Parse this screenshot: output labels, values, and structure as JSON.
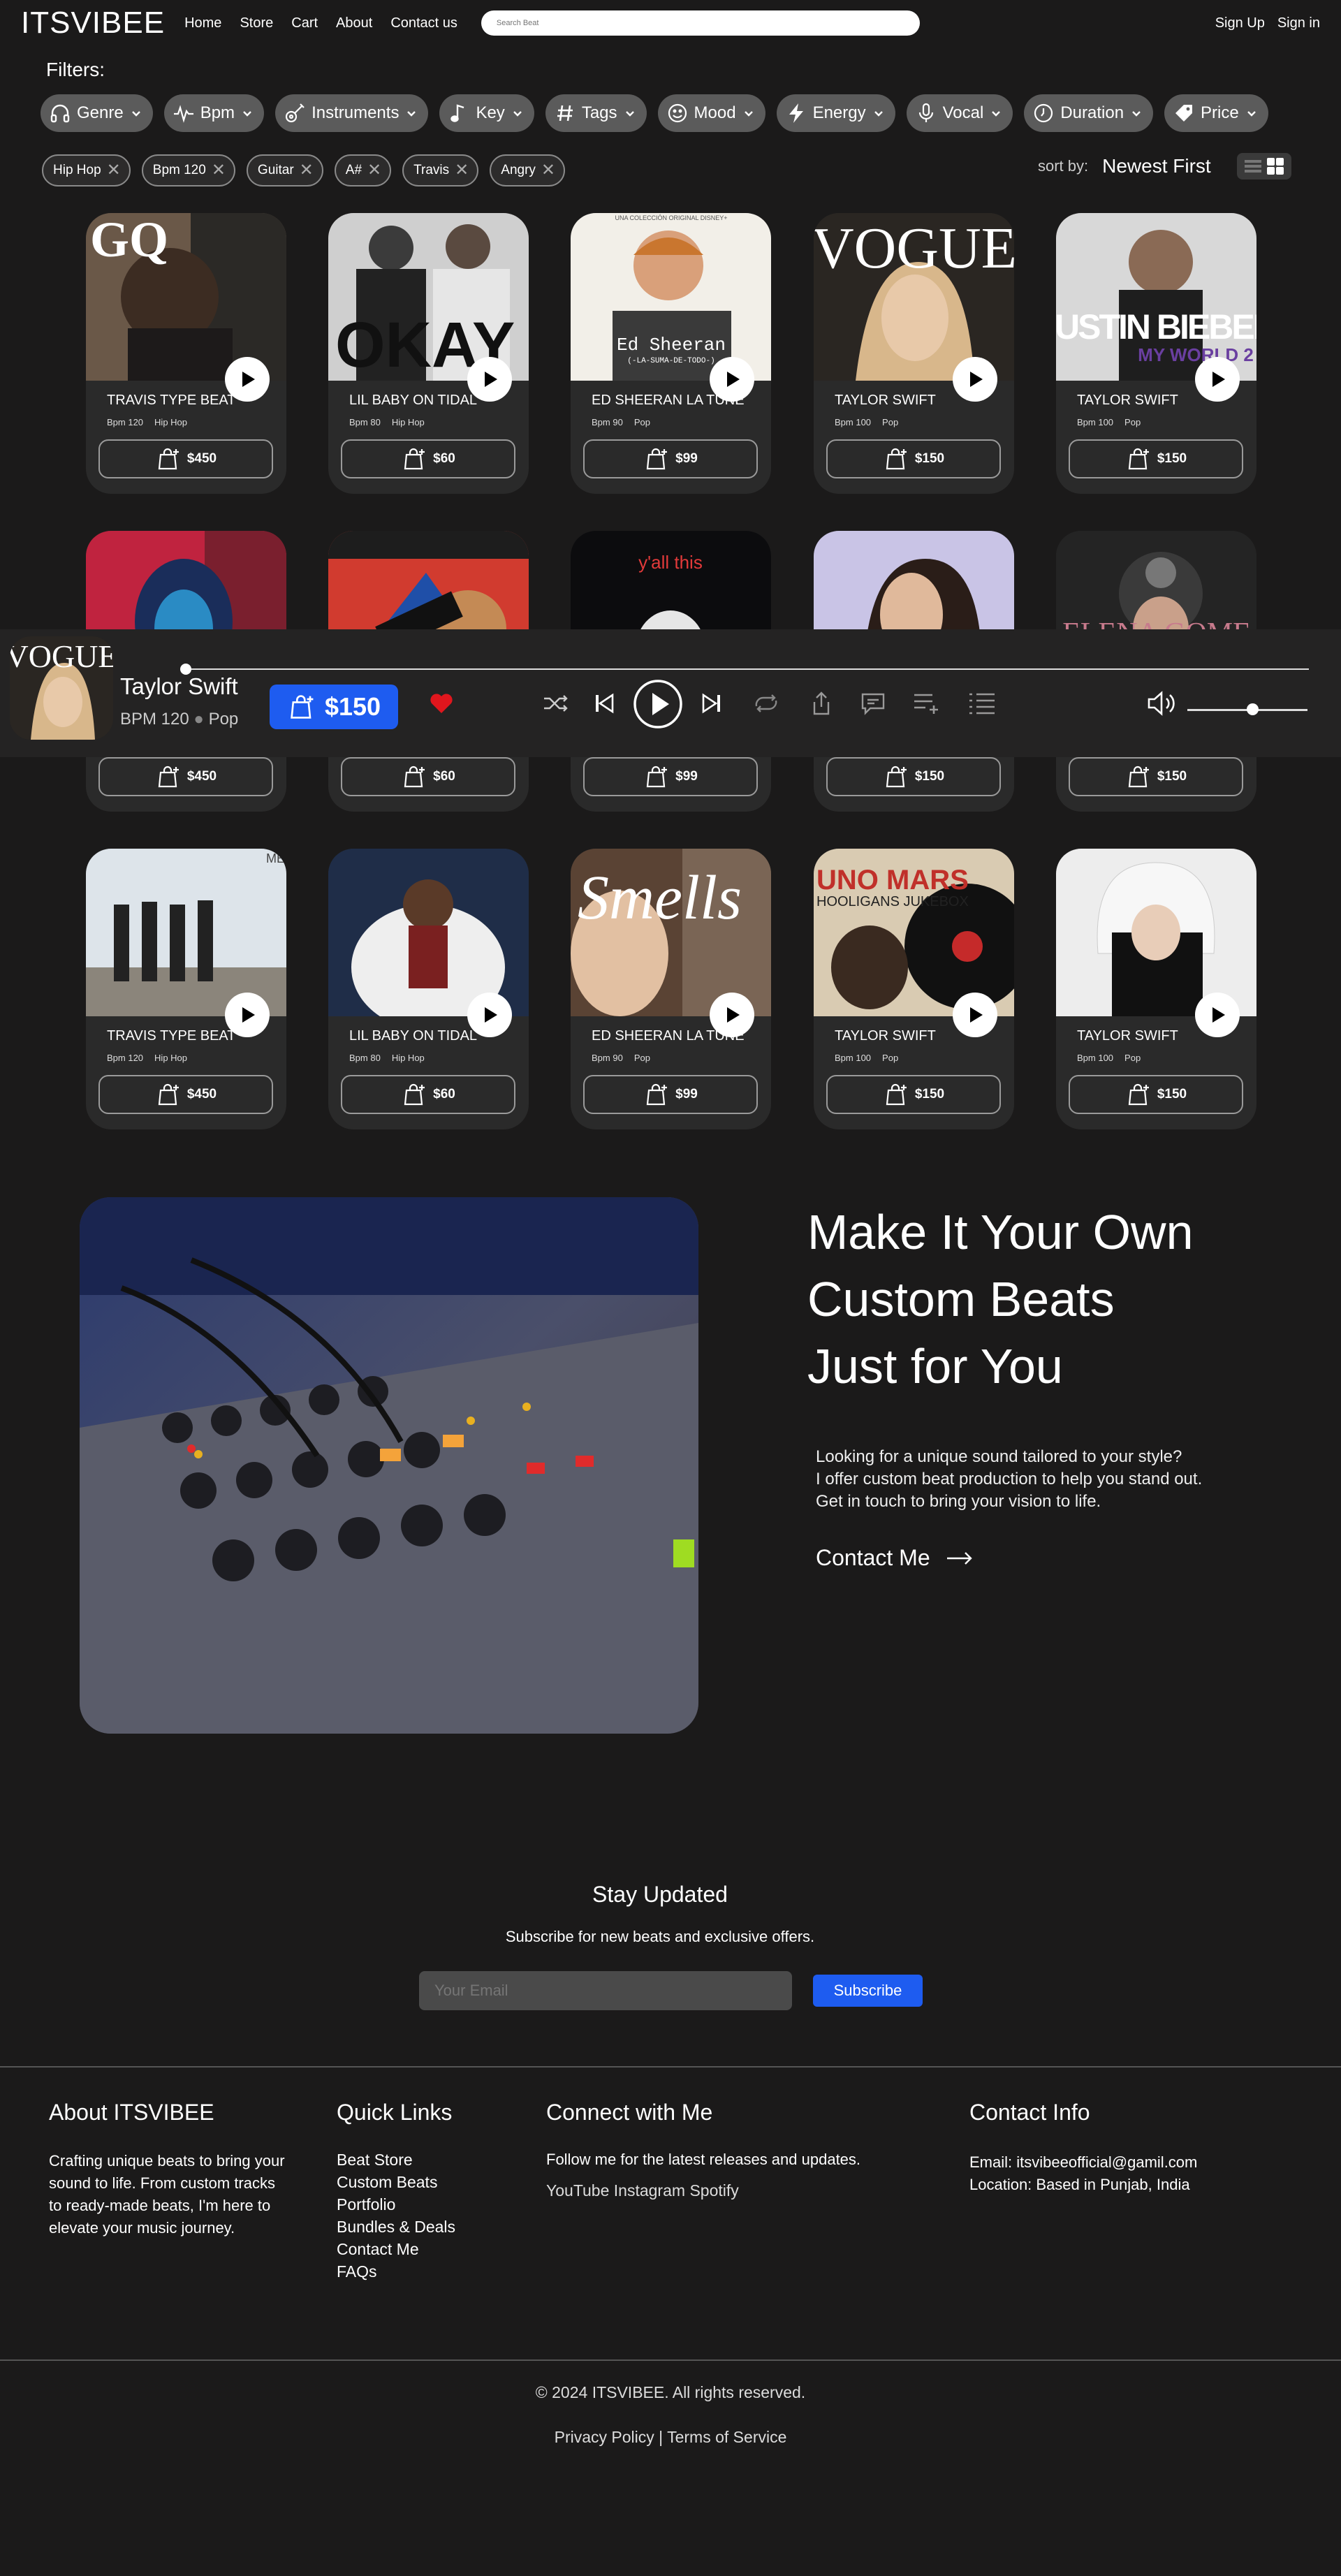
{
  "nav": {
    "logo": "ITSVIBEE",
    "links": [
      "Home",
      "Store",
      "Cart",
      "About",
      "Contact us"
    ],
    "search_placeholder": "Search Beat",
    "signup": "Sign Up",
    "signin": "Sign in"
  },
  "filters": {
    "label": "Filters:",
    "chips": [
      {
        "label": "Genre",
        "icon": "headphones-icon"
      },
      {
        "label": "Bpm",
        "icon": "pulse-icon"
      },
      {
        "label": "Instruments",
        "icon": "guitar-icon"
      },
      {
        "label": "Key",
        "icon": "music-note-icon"
      },
      {
        "label": "Tags",
        "icon": "hashtag-icon"
      },
      {
        "label": "Mood",
        "icon": "smiley-icon"
      },
      {
        "label": "Energy",
        "icon": "lightning-icon"
      },
      {
        "label": "Vocal",
        "icon": "microphone-icon"
      },
      {
        "label": "Duration",
        "icon": "clock-icon"
      },
      {
        "label": "Price",
        "icon": "price-tag-icon"
      }
    ],
    "active_tags": [
      "Hip Hop",
      "Bpm 120",
      "Guitar",
      "A#",
      "Travis",
      "Angry"
    ],
    "sort_label": "sort by:",
    "sort_value": "Newest First"
  },
  "beats": [
    {
      "title": "TRAVIS TYPE BEAT",
      "bpm": "Bpm 120",
      "genre": "Hip Hop",
      "price": "$450"
    },
    {
      "title": "LIL BABY ON TIDAL",
      "bpm": "Bpm 80",
      "genre": "Hip Hop",
      "price": "$60"
    },
    {
      "title": "ED SHEERAN LA TUNE",
      "bpm": "Bpm 90",
      "genre": "Pop",
      "price": "$99"
    },
    {
      "title": "TAYLOR SWIFT",
      "bpm": "Bpm 100",
      "genre": "Pop",
      "price": "$150"
    },
    {
      "title": "TAYLOR SWIFT",
      "bpm": "Bpm 100",
      "genre": "Pop",
      "price": "$150"
    }
  ],
  "cover_text": {
    "gq": "GQ",
    "okay": "OKAY",
    "ed": "Ed Sheeran",
    "ed_sub": "(-LA-SUMA-DE-TODO-)",
    "ed_top": "UNA COLECCIÓN ORIGINAL DISNEY+",
    "vogue": "VOGUE",
    "justin": "JUSTIN BIEBER",
    "justin_sub": "MY WORLD 2",
    "yall": "y'all this",
    "selena": "ELENA GOME",
    "smells": "Smells",
    "bruno": "UNO MARS",
    "bruno_sub": "HOOLIGANS JUKEBOX"
  },
  "player": {
    "name": "Taylor Swift",
    "bpm": "BPM 120",
    "genre": "Pop",
    "price": "$150",
    "progress": 0.0,
    "volume": 0.5
  },
  "custom": {
    "heading": [
      "Make It Your Own",
      "Custom Beats",
      "Just for You"
    ],
    "desc": [
      "Looking for a unique sound tailored to your style?",
      "I offer custom beat production to help you stand out.",
      "Get in touch to bring your vision to life."
    ],
    "cta": "Contact Me"
  },
  "newsletter": {
    "title": "Stay Updated",
    "subtitle": "Subscribe for new beats and exclusive offers.",
    "placeholder": "Your Email",
    "button": "Subscribe"
  },
  "footer": {
    "about_title": "About ITSVIBEE",
    "about_text": [
      "Crafting unique beats to bring your",
      "sound to life. From custom tracks",
      "to ready-made beats, I'm here to",
      "elevate your music journey."
    ],
    "quick_title": "Quick Links",
    "quick_links": [
      "Beat Store",
      "Custom Beats",
      "Portfolio",
      "Bundles & Deals",
      "Contact Me",
      "FAQs"
    ],
    "connect_title": "Connect with Me",
    "connect_text": "Follow me for the latest releases and updates.",
    "socials": [
      "YouTube",
      "Instagram",
      "Spotify"
    ],
    "contact_title": "Contact Info",
    "email": "Email: itsvibeeofficial@gamil.com",
    "location": "Location: Based in Punjab, India",
    "copyright": "© 2024 ITSVIBEE. All rights reserved.",
    "privacy": "Privacy Policy",
    "terms": "Terms of Service"
  }
}
